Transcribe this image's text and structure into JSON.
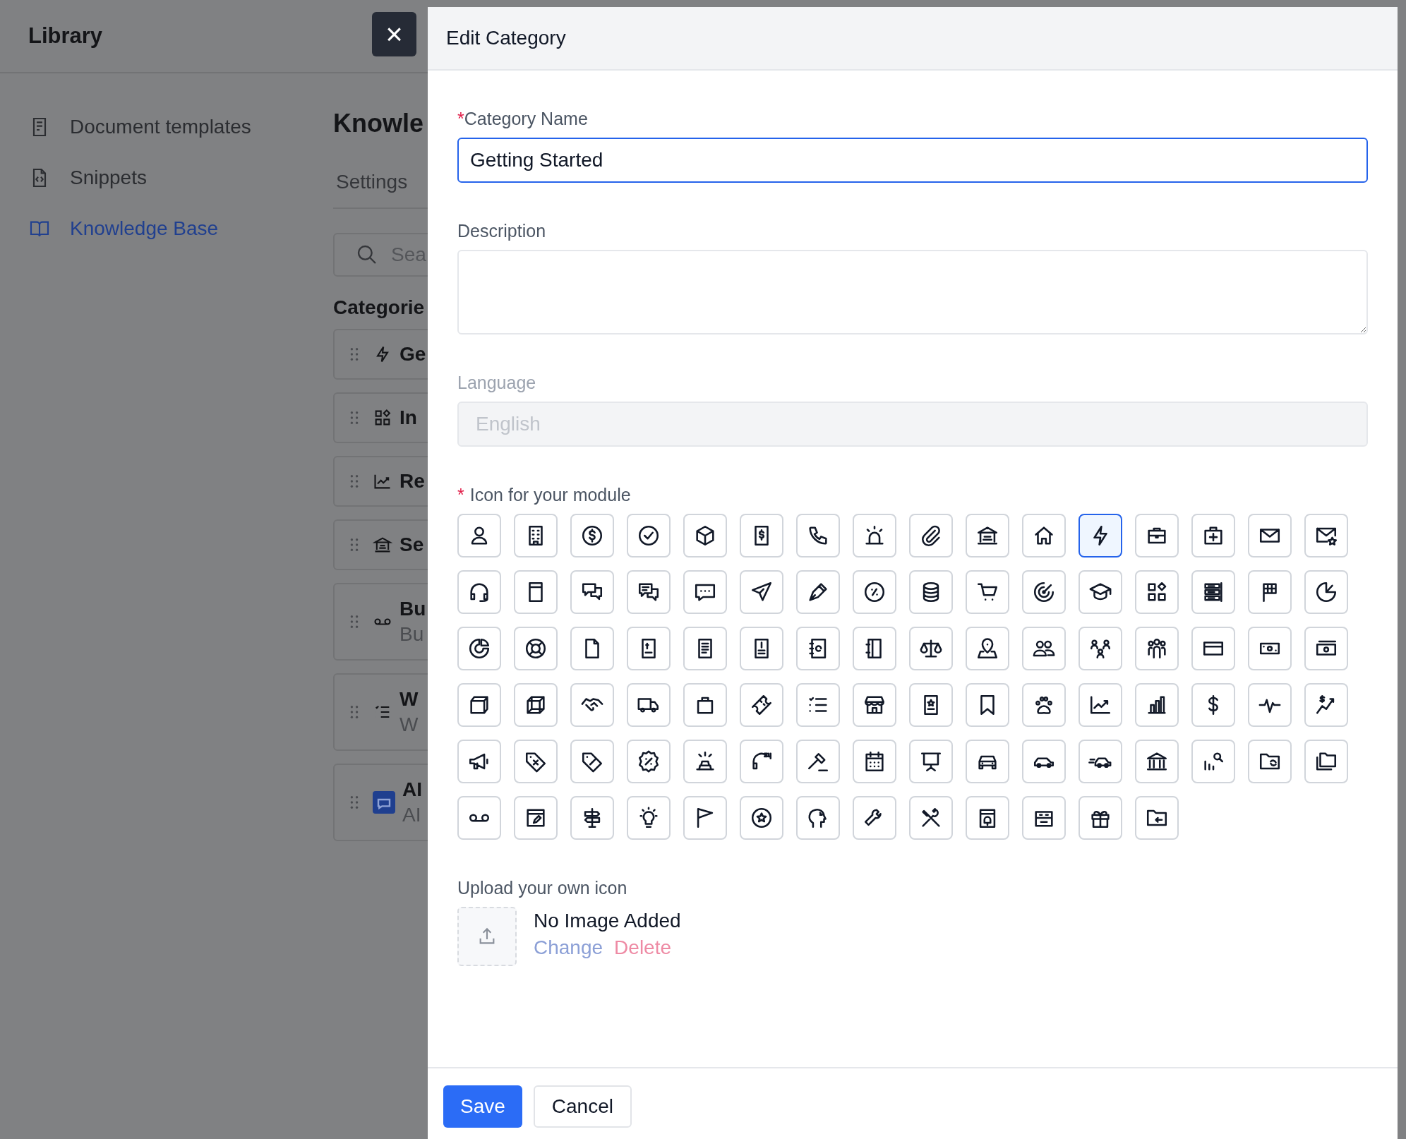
{
  "background_page": {
    "header": {
      "title": "Library",
      "close_button": "×"
    },
    "sidebar": {
      "items": [
        {
          "label": "Document templates",
          "selected": false
        },
        {
          "label": "Snippets",
          "selected": false
        },
        {
          "label": "Knowledge Base",
          "selected": true
        }
      ]
    },
    "content": {
      "heading": "Knowle",
      "tab": "Settings",
      "search": {
        "placeholder": "Sea"
      },
      "section_title": "Categorie",
      "categories": [
        {
          "title": "Ge"
        },
        {
          "title": "In"
        },
        {
          "title": "Re"
        },
        {
          "title": "Se"
        },
        {
          "title": "Bu",
          "subtitle": "Bu"
        },
        {
          "title": "W",
          "subtitle": "W"
        },
        {
          "title": "AI",
          "subtitle": "AI"
        }
      ]
    }
  },
  "drawer": {
    "title": "Edit Category",
    "category_name": {
      "required_mark": "*",
      "label": "Category Name",
      "value": "Getting Started",
      "focused": true
    },
    "description": {
      "label": "Description"
    },
    "language": {
      "label": "Language",
      "value": "English",
      "disabled": true
    },
    "icon_picker": {
      "required_mark": "*",
      "label": "Icon for your module",
      "options": [
        {
          "selected": false
        },
        {
          "selected": false
        },
        {
          "selected": false
        },
        {
          "selected": false
        },
        {
          "selected": false
        },
        {
          "selected": false
        },
        {
          "selected": false
        },
        {
          "selected": false
        },
        {
          "selected": false
        },
        {
          "selected": false
        },
        {
          "selected": false
        },
        {
          "selected": true
        },
        {
          "selected": false
        },
        {
          "selected": false
        },
        {
          "selected": false
        },
        {
          "selected": false
        },
        {
          "selected": false
        },
        {
          "selected": false
        },
        {
          "selected": false
        },
        {
          "selected": false
        },
        {
          "selected": false
        },
        {
          "selected": false
        },
        {
          "selected": false
        },
        {
          "selected": false
        },
        {
          "selected": false
        },
        {
          "selected": false
        },
        {
          "selected": false
        },
        {
          "selected": false
        },
        {
          "selected": false
        },
        {
          "selected": false
        },
        {
          "selected": false
        },
        {
          "selected": false
        },
        {
          "selected": false
        },
        {
          "selected": false
        },
        {
          "selected": false
        },
        {
          "selected": false
        },
        {
          "selected": false
        },
        {
          "selected": false
        },
        {
          "selected": false
        },
        {
          "selected": false
        },
        {
          "selected": false
        },
        {
          "selected": false
        },
        {
          "selected": false
        },
        {
          "selected": false
        },
        {
          "selected": false
        },
        {
          "selected": false
        },
        {
          "selected": false
        },
        {
          "selected": false
        },
        {
          "selected": false
        },
        {
          "selected": false
        },
        {
          "selected": false
        },
        {
          "selected": false
        },
        {
          "selected": false
        },
        {
          "selected": false
        },
        {
          "selected": false
        },
        {
          "selected": false
        },
        {
          "selected": false
        },
        {
          "selected": false
        },
        {
          "selected": false
        },
        {
          "selected": false
        },
        {
          "selected": false
        },
        {
          "selected": false
        },
        {
          "selected": false
        },
        {
          "selected": false
        },
        {
          "selected": false
        },
        {
          "selected": false
        },
        {
          "selected": false
        },
        {
          "selected": false
        },
        {
          "selected": false
        },
        {
          "selected": false
        },
        {
          "selected": false
        },
        {
          "selected": false
        },
        {
          "selected": false
        },
        {
          "selected": false
        },
        {
          "selected": false
        },
        {
          "selected": false
        },
        {
          "selected": false
        },
        {
          "selected": false
        },
        {
          "selected": false
        },
        {
          "selected": false
        },
        {
          "selected": false
        },
        {
          "selected": false
        },
        {
          "selected": false
        },
        {
          "selected": false
        },
        {
          "selected": false
        },
        {
          "selected": false
        },
        {
          "selected": false
        },
        {
          "selected": false
        },
        {
          "selected": false
        },
        {
          "selected": false
        },
        {
          "selected": false
        },
        {
          "selected": false
        },
        {
          "selected": false
        }
      ]
    },
    "upload": {
      "label": "Upload your own icon",
      "status": "No Image Added",
      "change_link": "Change",
      "delete_link": "Delete"
    },
    "buttons": [
      {
        "label": "Save",
        "kind": "primary"
      },
      {
        "label": "Cancel",
        "kind": "secondary"
      }
    ]
  }
}
